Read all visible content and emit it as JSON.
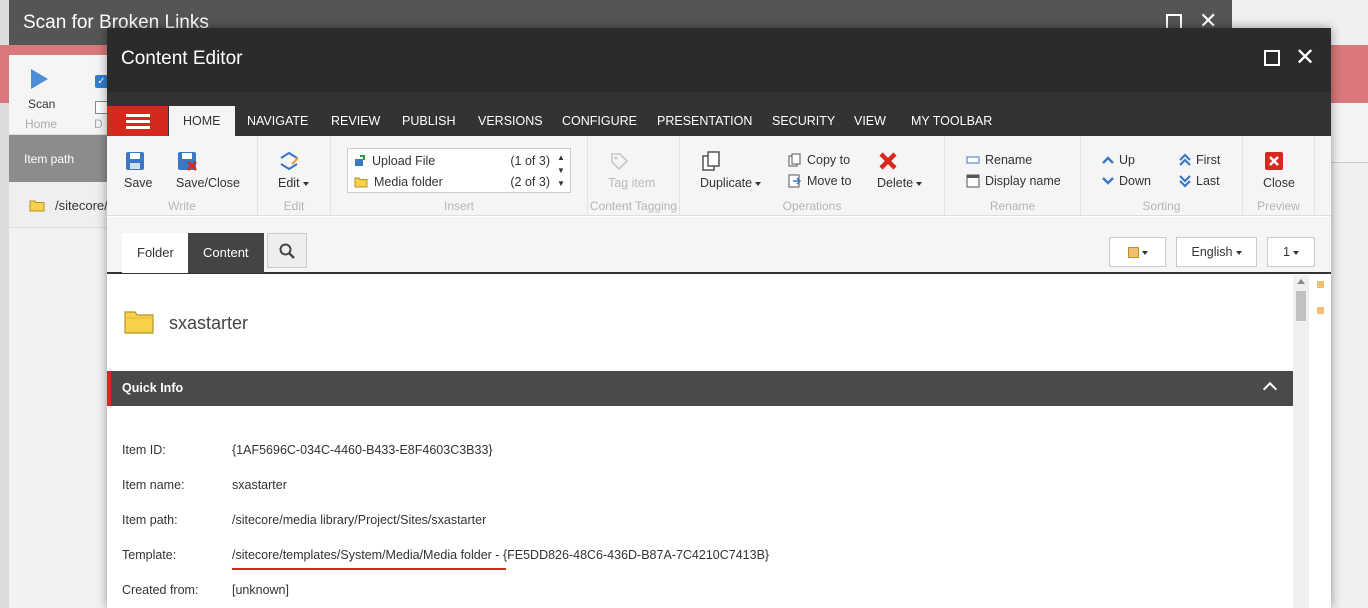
{
  "background_window": {
    "title": "Scan for Broken Links",
    "scan_label": "Scan",
    "home_group": "Home",
    "d_group": "D",
    "item_path_header": "Item path",
    "row_path": "/sitecore/"
  },
  "window": {
    "title": "Content Editor"
  },
  "tabs": [
    "HOME",
    "NAVIGATE",
    "REVIEW",
    "PUBLISH",
    "VERSIONS",
    "CONFIGURE",
    "PRESENTATION",
    "SECURITY",
    "VIEW",
    "MY TOOLBAR"
  ],
  "ribbon": {
    "write": {
      "label": "Write",
      "save": "Save",
      "save_close": "Save/Close"
    },
    "edit": {
      "label": "Edit",
      "edit": "Edit"
    },
    "insert": {
      "label": "Insert",
      "items": [
        {
          "label": "Upload File",
          "count": "(1 of 3)",
          "icon": "upload-file-icon"
        },
        {
          "label": "Media folder",
          "count": "(2 of 3)",
          "icon": "folder-icon"
        }
      ]
    },
    "content_tagging": {
      "label": "Content Tagging",
      "tag_item": "Tag item"
    },
    "operations": {
      "label": "Operations",
      "duplicate": "Duplicate",
      "copy_to": "Copy to",
      "move_to": "Move to",
      "delete": "Delete"
    },
    "rename": {
      "label": "Rename",
      "rename": "Rename",
      "display_name": "Display name"
    },
    "sorting": {
      "label": "Sorting",
      "up": "Up",
      "down": "Down",
      "first": "First",
      "last": "Last"
    },
    "preview": {
      "label": "Preview",
      "close": "Close"
    }
  },
  "content_toolbar": {
    "folder_tab": "Folder",
    "content_tab": "Content",
    "language": "English",
    "version": "1"
  },
  "item": {
    "name": "sxastarter"
  },
  "quick_info": {
    "header": "Quick Info",
    "fields": [
      {
        "label": "Item ID:",
        "value": "{1AF5696C-034C-4460-B433-E8F4603C3B33}"
      },
      {
        "label": "Item name:",
        "value": "sxastarter"
      },
      {
        "label": "Item path:",
        "value": "/sitecore/media library/Project/Sites/sxastarter"
      },
      {
        "label": "Template:",
        "value": "/sitecore/templates/System/Media/Media folder - {FE5DD826-48C6-436D-B87A-7C4210C7413B}"
      },
      {
        "label": "Created from:",
        "value": "[unknown]"
      }
    ]
  },
  "colors": {
    "accent_red": "#d6281f",
    "titlebar": "#2b2b2b",
    "quick_info_bar": "#4a4a4a"
  }
}
